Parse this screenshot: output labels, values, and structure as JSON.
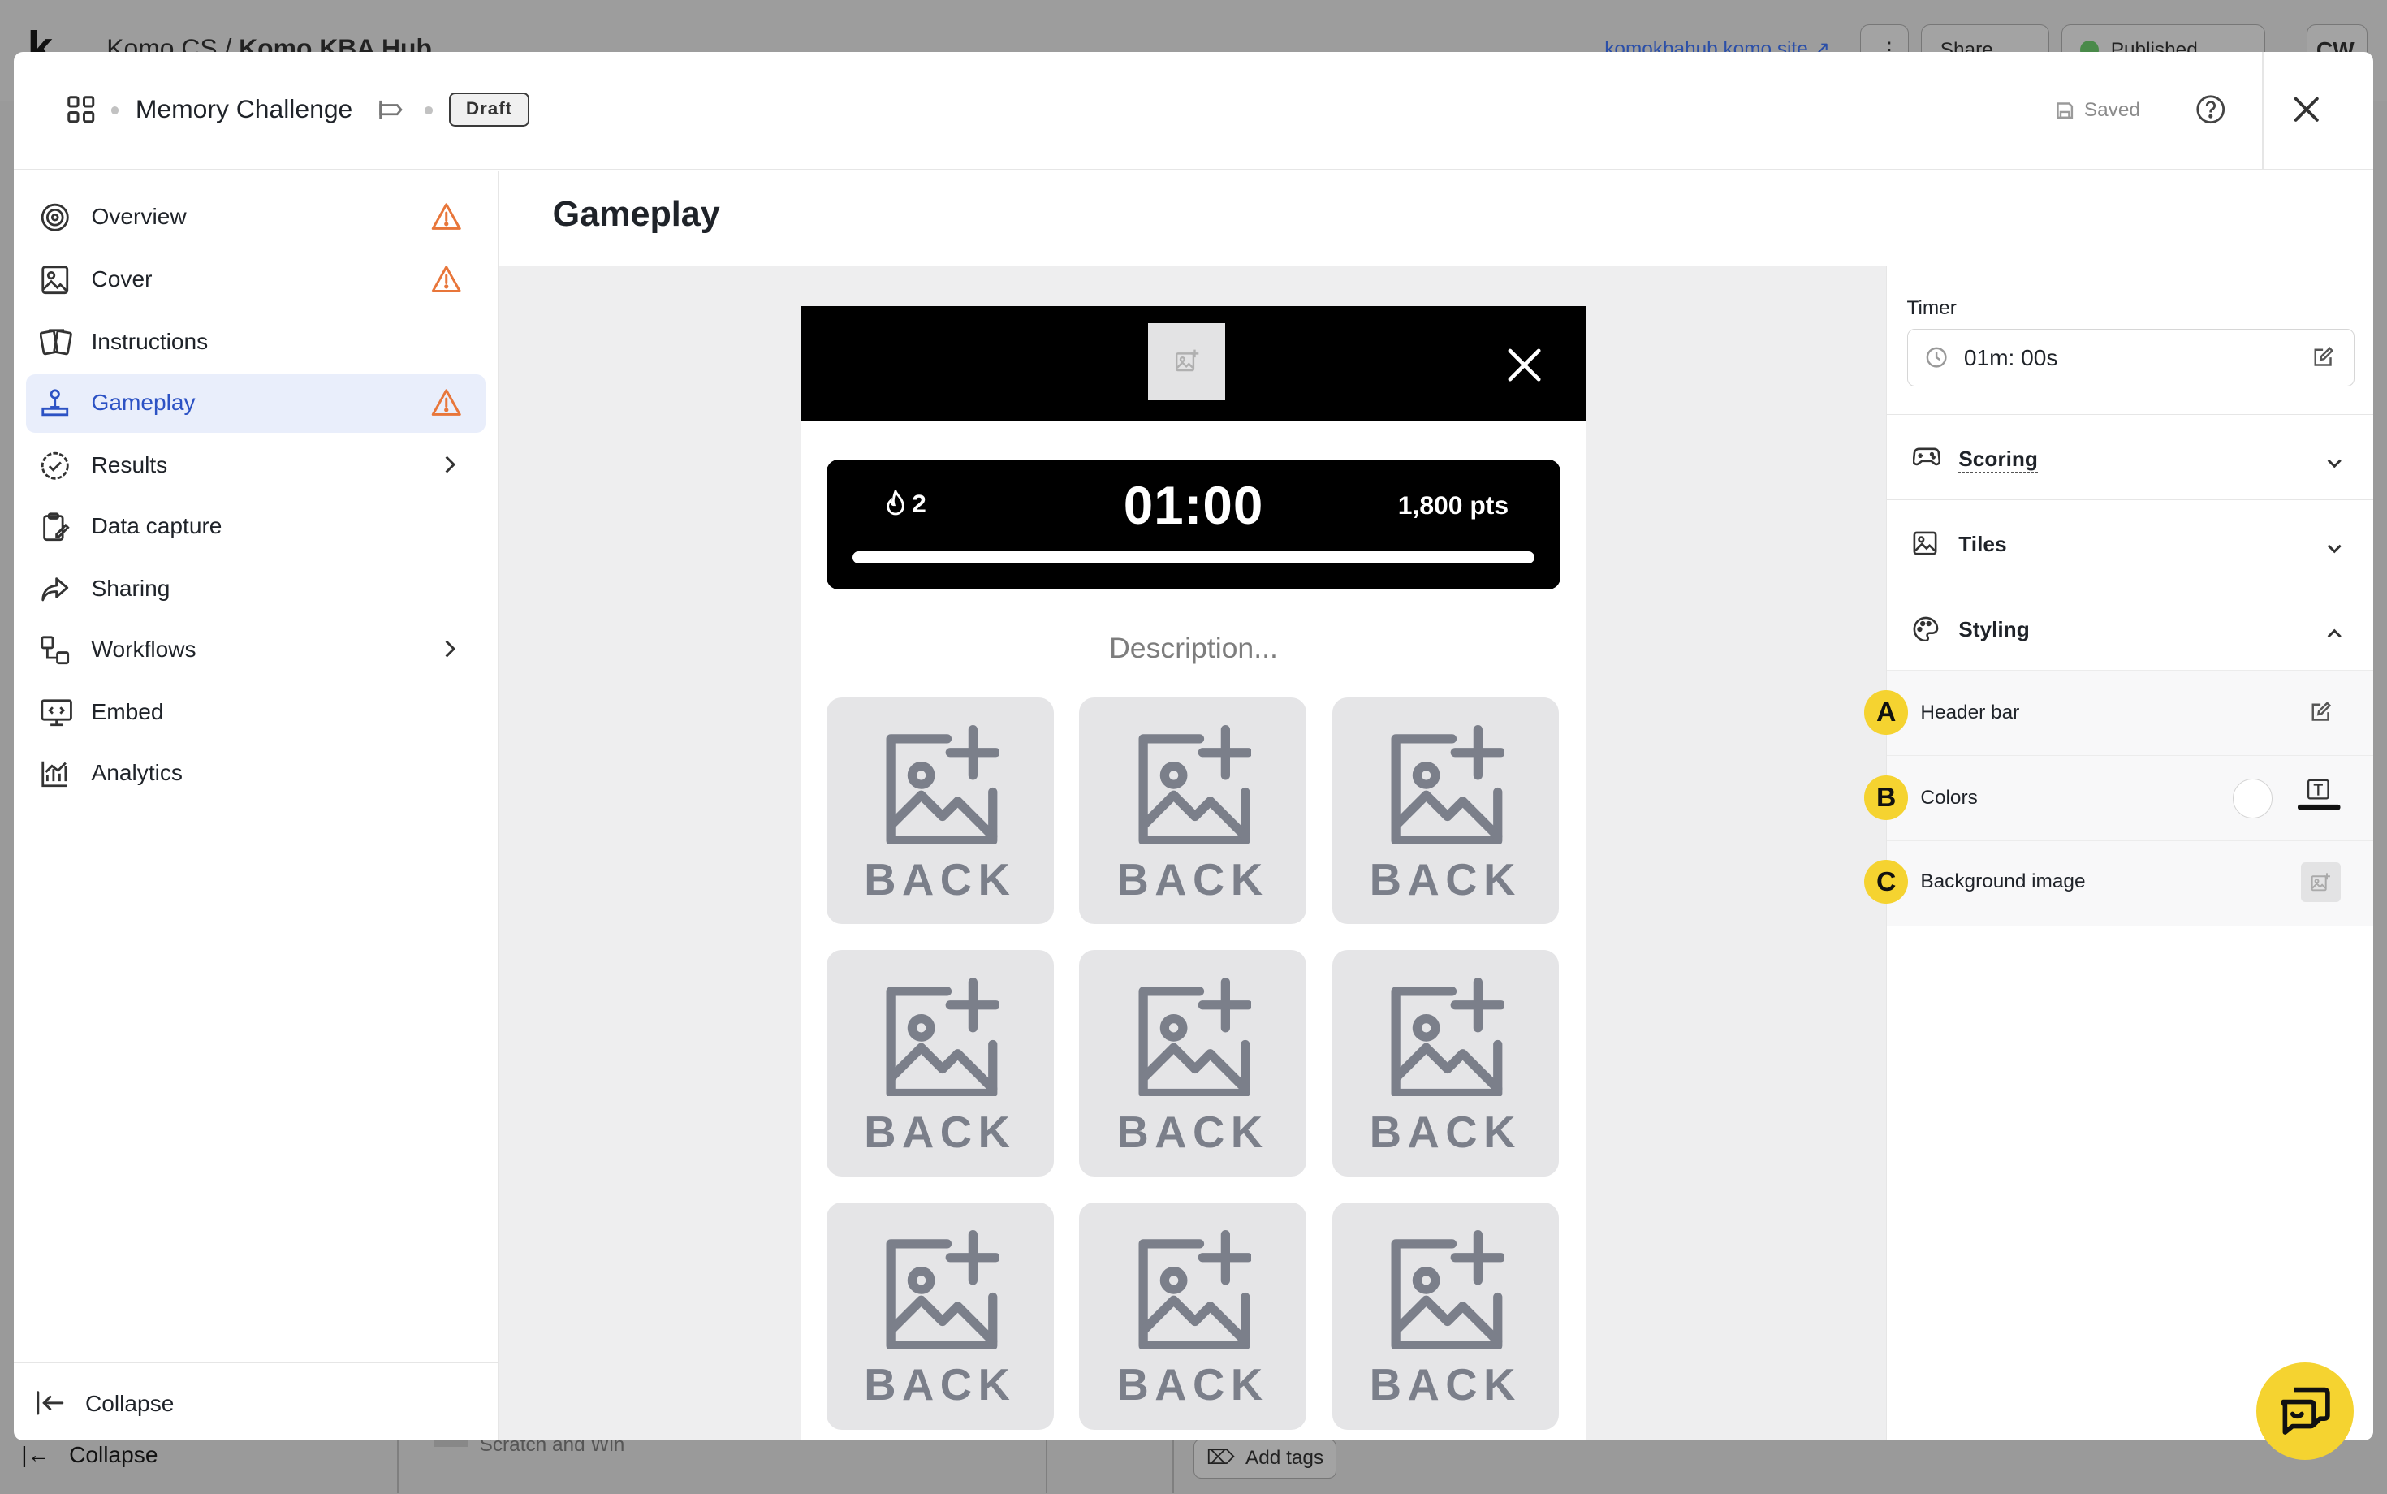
{
  "background": {
    "logo": "k",
    "breadcrumb_org": "Komo CS",
    "breadcrumb_sep": "/",
    "breadcrumb_hub": "Komo KBA Hub",
    "site_link": "komokbahub.komo.site",
    "share_label": "Share",
    "published_label": "Published",
    "avatar_initials": "CW",
    "collapse_label": "Collapse",
    "scratch_label": "Scratch and Win",
    "add_tags_label": "Add tags"
  },
  "header": {
    "title": "Memory Challenge",
    "status_badge": "Draft",
    "saved_label": "Saved"
  },
  "sidebar": {
    "items": [
      {
        "label": "Overview",
        "icon": "target-icon",
        "warning": true
      },
      {
        "label": "Cover",
        "icon": "image-frame-icon",
        "warning": true
      },
      {
        "label": "Instructions",
        "icon": "cards-icon",
        "warning": false
      },
      {
        "label": "Gameplay",
        "icon": "joystick-icon",
        "warning": true,
        "active": true
      },
      {
        "label": "Results",
        "icon": "check-circle-icon",
        "chevron": true
      },
      {
        "label": "Data capture",
        "icon": "clipboard-icon"
      },
      {
        "label": "Sharing",
        "icon": "share-arrow-icon"
      },
      {
        "label": "Workflows",
        "icon": "workflow-icon",
        "chevron": true
      },
      {
        "label": "Embed",
        "icon": "embed-monitor-icon"
      },
      {
        "label": "Analytics",
        "icon": "analytics-icon"
      }
    ],
    "collapse_label": "Collapse"
  },
  "main": {
    "title": "Gameplay"
  },
  "preview": {
    "streak": "2",
    "timer": "01:00",
    "points": "1,800 pts",
    "progress": 1.0,
    "description": "Description...",
    "tile_label": "BACK",
    "tiles_visible": 9
  },
  "panel": {
    "timer_label": "Timer",
    "timer_value": "01m: 00s",
    "sections": {
      "scoring": "Scoring",
      "tiles": "Tiles",
      "styling": "Styling"
    },
    "styling_items": [
      {
        "badge": "A",
        "label": "Header bar"
      },
      {
        "badge": "B",
        "label": "Colors"
      },
      {
        "badge": "C",
        "label": "Background image"
      }
    ]
  },
  "colors": {
    "accent": "#2c52c4",
    "active_bg": "#e9eefb",
    "warning": "#e8763a",
    "badge_yellow": "#f5d330",
    "preview_black": "#000000",
    "tile_bg": "#e5e5e7",
    "tile_text": "#7b7f8a"
  }
}
